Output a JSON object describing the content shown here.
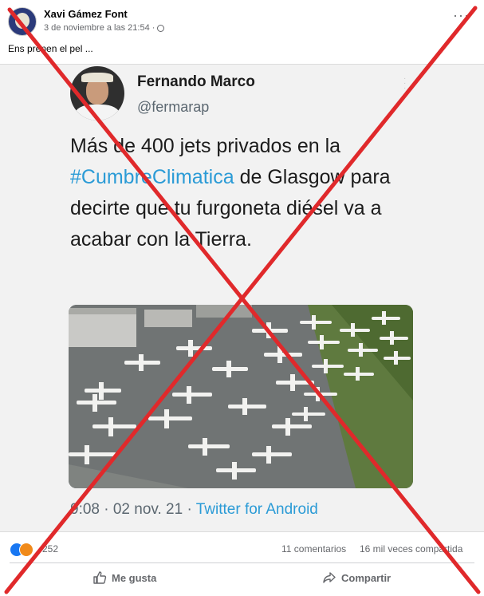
{
  "post": {
    "author": "Xavi Gámez Font",
    "timestamp": "3 de noviembre a las 21:54 ·",
    "caption": "Ens prenen el pel ...",
    "more_label": "···"
  },
  "tweet": {
    "name": "Fernando Marco",
    "handle": "@fermarap",
    "text_before": "Más de 400 jets privados en la ",
    "hashtag": "#CumbreClimatica",
    "text_after": " de Glasgow para decirte que tu furgoneta diésel va a acabar con la Tierra.",
    "time_date": "9:08 · 02 nov. 21 · ",
    "client": "Twitter for Android"
  },
  "stats": {
    "reactions": "252",
    "comments": "11 comentarios",
    "shares": "16 mil veces compartida"
  },
  "actions": {
    "like_label": "Me gusta",
    "share_label": "Compartir"
  },
  "colors": {
    "cross": "#e0292b",
    "link": "#2b9bd6",
    "fb_blue": "#1877f2"
  },
  "icons": {
    "avatar": "avatar",
    "privacy": "globe-icon",
    "options": "more-options-icon",
    "like": "thumbs-up-icon",
    "share": "share-arrow-icon"
  }
}
